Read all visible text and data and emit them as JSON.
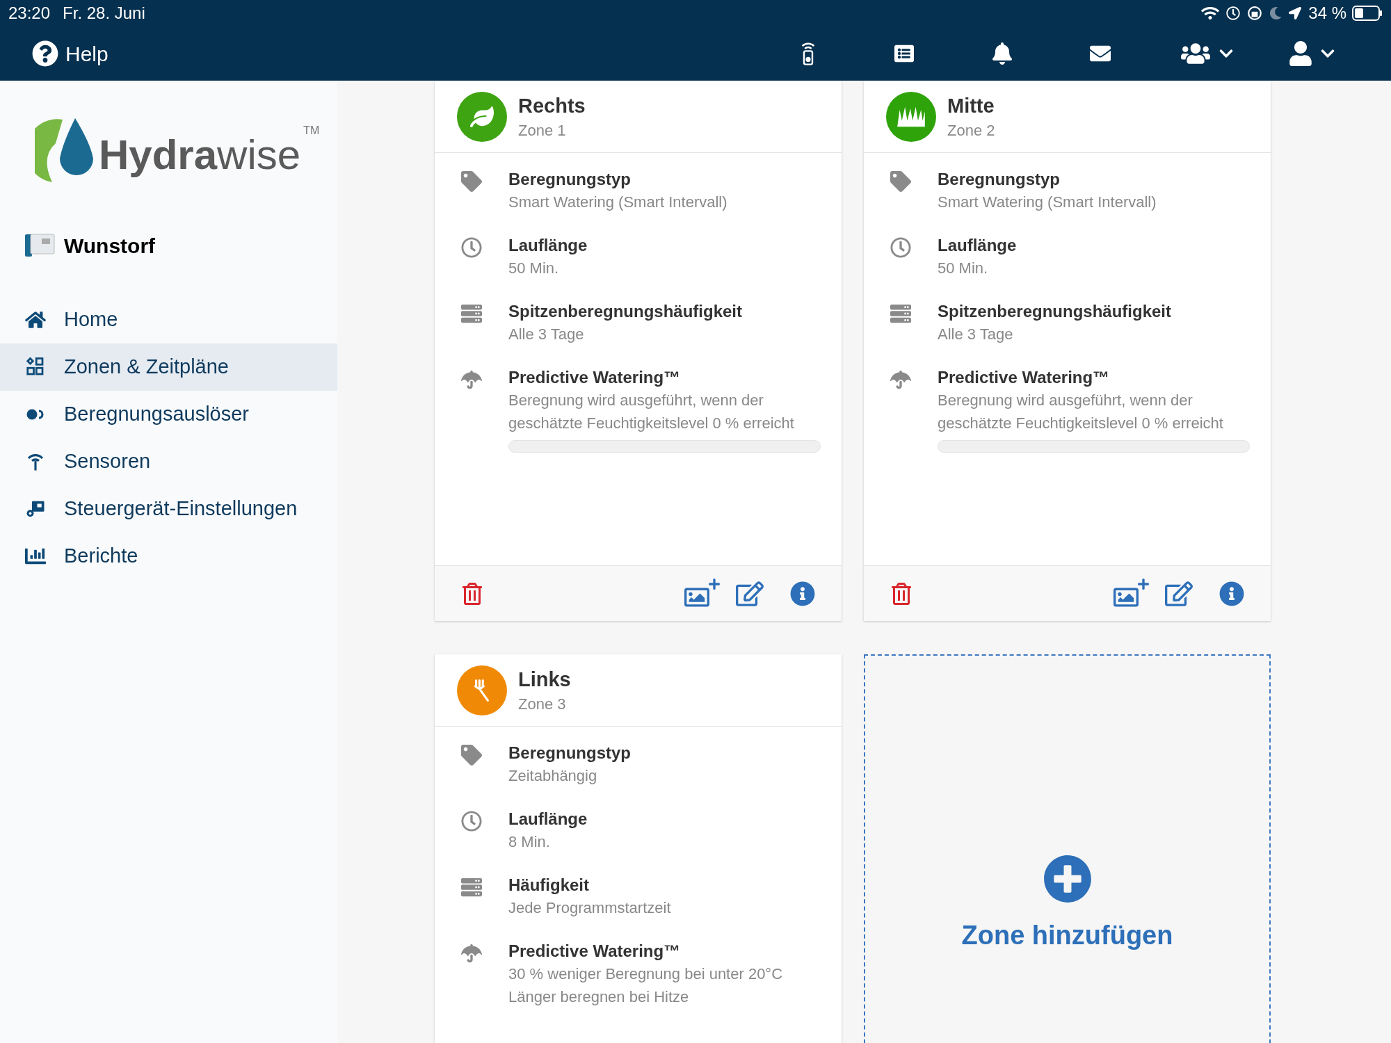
{
  "status_bar": {
    "time": "23:20",
    "date": "Fr. 28. Juni",
    "battery": "34 %"
  },
  "header": {
    "help": "Help"
  },
  "sidebar": {
    "logo": {
      "bold": "Hydra",
      "light": "wise",
      "mark": "TM"
    },
    "controller": {
      "name": "Wunstorf"
    },
    "items": [
      {
        "label": "Home",
        "kind": "home",
        "selected": false
      },
      {
        "label": "Zonen & Zeitpläne",
        "kind": "grid",
        "selected": true
      },
      {
        "label": "Beregnungsauslöser",
        "kind": "toggle",
        "selected": false
      },
      {
        "label": "Sensoren",
        "kind": "antenna",
        "selected": false
      },
      {
        "label": "Steuergerät-Einstellungen",
        "kind": "controller",
        "selected": false
      },
      {
        "label": "Berichte",
        "kind": "chart",
        "selected": false
      }
    ]
  },
  "zones": [
    {
      "name": "Rechts",
      "zone": "Zone 1",
      "kind": "leaf",
      "color": "#3ea412",
      "footer": true,
      "details": [
        {
          "kind": "tag",
          "label": "Beregnungstyp",
          "value": "Smart Watering (Smart Intervall)"
        },
        {
          "kind": "clock",
          "label": "Lauflänge",
          "value": "50 Min."
        },
        {
          "kind": "list",
          "label": "Spitzenberegnungshäufigkeit",
          "value": "Alle 3 Tage"
        },
        {
          "kind": "umbrella",
          "label": "Predictive Watering™",
          "value": "Beregnung wird ausgeführt, wenn der geschätzte Feuchtigkeitslevel 0 % erreicht",
          "level": 0
        }
      ]
    },
    {
      "name": "Mitte",
      "zone": "Zone 2",
      "kind": "grass",
      "color": "#2fa30a",
      "footer": true,
      "details": [
        {
          "kind": "tag",
          "label": "Beregnungstyp",
          "value": "Smart Watering (Smart Intervall)"
        },
        {
          "kind": "clock",
          "label": "Lauflänge",
          "value": "50 Min."
        },
        {
          "kind": "list",
          "label": "Spitzenberegnungshäufigkeit",
          "value": "Alle 3 Tage"
        },
        {
          "kind": "umbrella",
          "label": "Predictive Watering™",
          "value": "Beregnung wird ausgeführt, wenn der geschätzte Feuchtigkeitslevel 0 % erreicht",
          "level": 0
        }
      ]
    },
    {
      "name": "Links",
      "zone": "Zone 3",
      "kind": "rake",
      "color": "#f08a06",
      "footer": false,
      "details": [
        {
          "kind": "tag",
          "label": "Beregnungstyp",
          "value": "Zeitabhängig"
        },
        {
          "kind": "clock",
          "label": "Lauflänge",
          "value": "8 Min."
        },
        {
          "kind": "list",
          "label": "Häufigkeit",
          "value": "Jede Programmstartzeit"
        },
        {
          "kind": "umbrella",
          "label": "Predictive Watering™",
          "value": "30 % weniger Beregnung bei unter 20°C\nLänger beregnen bei Hitze"
        }
      ]
    }
  ],
  "add_zone": {
    "label": "Zone hinzufügen"
  }
}
